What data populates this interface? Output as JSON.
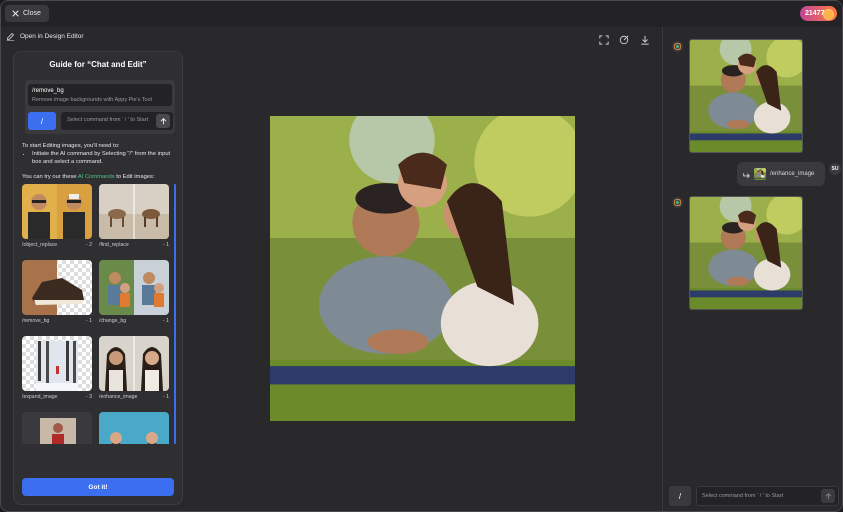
{
  "topbar": {
    "close_label": "Close",
    "credits": "21477"
  },
  "toolbar": {
    "open_editor_label": "Open in Design Editor"
  },
  "guide": {
    "title": "Guide for “Chat and Edit”",
    "example_command": "/remove_bg",
    "example_desc": "Remove image backgrounds with Appy Pie's Tool",
    "slash": "/",
    "input_placeholder": "Select command from ‘ / ’ to Start",
    "intro": "To start Editing images, you'll need to:",
    "step": "Initiate the AI command by Selecting \"/\" from the input box and select a command.",
    "try_prefix": "You can try our these ",
    "try_accent": "AI Commands",
    "try_suffix": " to Edit images:",
    "commands": [
      {
        "name": "/object_replace",
        "cost": "- 2"
      },
      {
        "name": "/find_replace",
        "cost": "- 1"
      },
      {
        "name": "/remove_bg",
        "cost": "- 1"
      },
      {
        "name": "/change_bg",
        "cost": "- 1"
      },
      {
        "name": "/expand_image",
        "cost": "- 3"
      },
      {
        "name": "/enhance_image",
        "cost": "- 1"
      }
    ],
    "got_it": "Got it!"
  },
  "chat": {
    "user_command": "/enhance_image",
    "user_avatar": "SU",
    "slash": "/",
    "input_placeholder": "Select command from ‘ / ’ to Start"
  },
  "colors": {
    "accent": "#3b6ff0",
    "link_green": "#4fc38a",
    "credits_from": "#c2469a",
    "credits_to": "#ff7a3d"
  }
}
